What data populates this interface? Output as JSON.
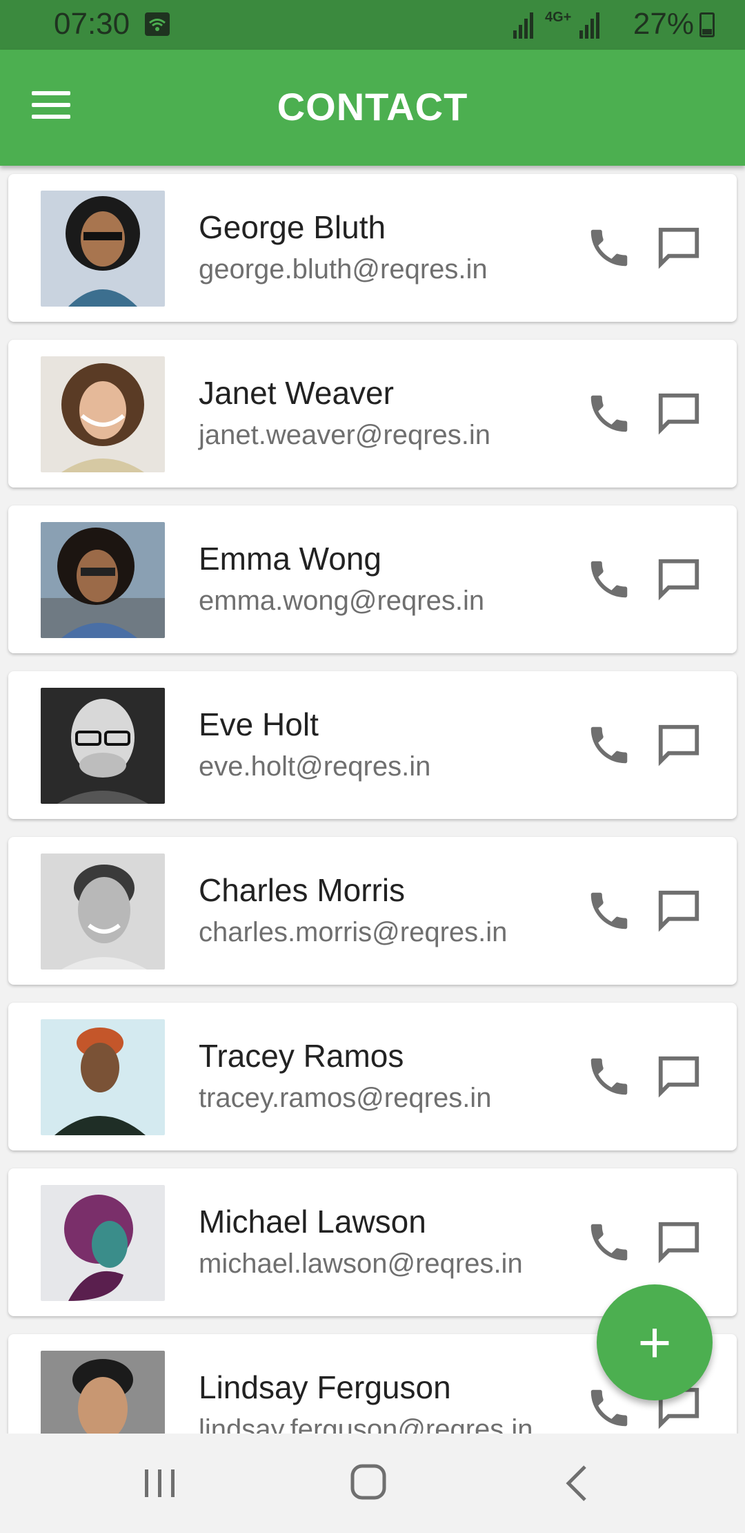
{
  "status_bar": {
    "time": "07:30",
    "network": "4G+",
    "battery": "27%"
  },
  "app_bar": {
    "title": "CONTACT",
    "menu_icon": "hamburger-menu-icon"
  },
  "contacts": [
    {
      "name": "George Bluth",
      "email": "george.bluth@reqres.in"
    },
    {
      "name": "Janet Weaver",
      "email": "janet.weaver@reqres.in"
    },
    {
      "name": "Emma Wong",
      "email": "emma.wong@reqres.in"
    },
    {
      "name": "Eve Holt",
      "email": "eve.holt@reqres.in"
    },
    {
      "name": "Charles Morris",
      "email": "charles.morris@reqres.in"
    },
    {
      "name": "Tracey Ramos",
      "email": "tracey.ramos@reqres.in"
    },
    {
      "name": "Michael Lawson",
      "email": "michael.lawson@reqres.in"
    },
    {
      "name": "Lindsay Ferguson",
      "email": "lindsay.ferguson@reqres.in"
    }
  ],
  "fab": {
    "label": "+"
  },
  "colors": {
    "primary": "#4caf50",
    "status_bar": "#3b8a3e",
    "icon_gray": "#6f6f6f"
  }
}
